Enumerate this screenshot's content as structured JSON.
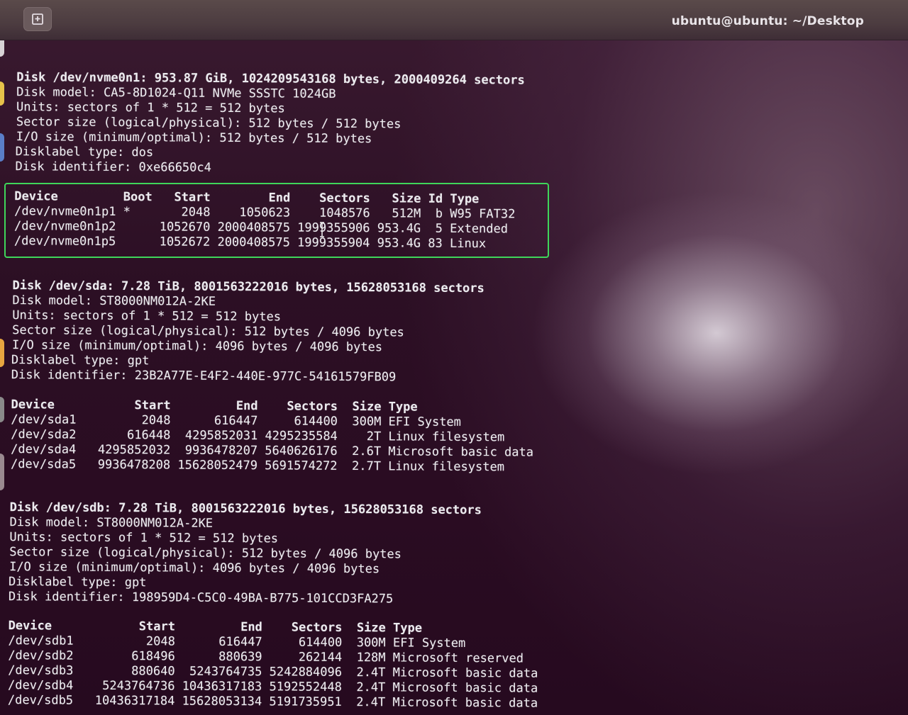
{
  "window": {
    "title": "ubuntu@ubuntu: ~/Desktop"
  },
  "icons": {
    "new_tab": "new-tab-icon"
  },
  "colors": {
    "highlight": "#3fd65a",
    "text": "#ecebef"
  },
  "terminal": {
    "lines": [
      "Disk /dev/nvme0n1: 953.87 GiB, 1024209543168 bytes, 2000409264 sectors",
      "Disk model: CA5-8D1024-Q11 NVMe SSSTC 1024GB",
      "Units: sectors of 1 * 512 = 512 bytes",
      "Sector size (logical/physical): 512 bytes / 512 bytes",
      "I/O size (minimum/optimal): 512 bytes / 512 bytes",
      "Disklabel type: dos",
      "Disk identifier: 0xe66650c4",
      "Device         Boot   Start        End    Sectors   Size Id Type",
      "/dev/nvme0n1p1 *       2048    1050623    1048576   512M  b W95 FAT32",
      "/dev/nvme0n1p2      1052670 2000408575 1999355906 953.4G  5 Extended",
      "/dev/nvme0n1p5      1052672 2000408575 1999355904 953.4G 83 Linux",
      "Disk /dev/sda: 7.28 TiB, 8001563222016 bytes, 15628053168 sectors",
      "Disk model: ST8000NM012A-2KE",
      "Units: sectors of 1 * 512 = 512 bytes",
      "Sector size (logical/physical): 512 bytes / 4096 bytes",
      "I/O size (minimum/optimal): 4096 bytes / 4096 bytes",
      "Disklabel type: gpt",
      "Disk identifier: 23B2A77E-E4F2-440E-977C-54161579FB09",
      "Device           Start         End    Sectors  Size Type",
      "/dev/sda1         2048      616447     614400  300M EFI System",
      "/dev/sda2       616448  4295852031 4295235584    2T Linux filesystem",
      "/dev/sda4   4295852032  9936478207 5640626176  2.6T Microsoft basic data",
      "/dev/sda5   9936478208 15628052479 5691574272  2.7T Linux filesystem",
      "Disk /dev/sdb: 7.28 TiB, 8001563222016 bytes, 15628053168 sectors",
      "Disk model: ST8000NM012A-2KE",
      "Units: sectors of 1 * 512 = 512 bytes",
      "Sector size (logical/physical): 512 bytes / 4096 bytes",
      "I/O size (minimum/optimal): 4096 bytes / 4096 bytes",
      "Disklabel type: gpt",
      "Disk identifier: 198959D4-C5C0-49BA-B775-101CCD3FA275",
      "Device            Start         End    Sectors  Size Type",
      "/dev/sdb1          2048      616447     614400  300M EFI System",
      "/dev/sdb2        618496      880639     262144  128M Microsoft reserved",
      "/dev/sdb3        880640  5243764735 5242884096  2.4T Microsoft basic data",
      "/dev/sdb4    5243764736 10436317183 5192552448  2.4T Microsoft basic data",
      "/dev/sdb5   10436317184 15628053134 5191735951  2.4T Microsoft basic data"
    ]
  }
}
